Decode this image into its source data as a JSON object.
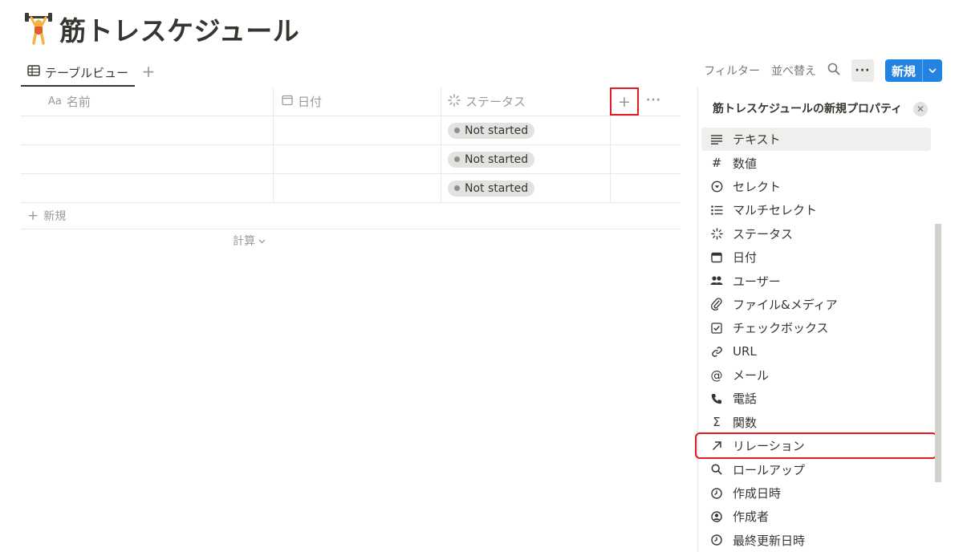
{
  "page": {
    "title": "筋トレスケジュール",
    "emoji": "weight-lifter-icon"
  },
  "tabs": {
    "active_label": "テーブルビュー",
    "add_label": "+"
  },
  "toolbar": {
    "filter": "フィルター",
    "sort": "並べ替え",
    "new": "新規"
  },
  "table": {
    "columns": [
      {
        "name": "名前",
        "icon": "Aa"
      },
      {
        "name": "日付",
        "icon": "calendar-icon"
      },
      {
        "name": "ステータス",
        "icon": "status-icon"
      }
    ],
    "rows": [
      {
        "status": "Not started"
      },
      {
        "status": "Not started"
      },
      {
        "status": "Not started"
      }
    ],
    "add_column": "+",
    "new_row": "新規",
    "calc": "計算"
  },
  "panel": {
    "title": "筋トレスケジュールの新規プロパティ",
    "items": [
      {
        "label": "テキスト",
        "icon": "text-icon"
      },
      {
        "label": "数値",
        "icon": "number-icon"
      },
      {
        "label": "セレクト",
        "icon": "select-icon"
      },
      {
        "label": "マルチセレクト",
        "icon": "multi-select-icon"
      },
      {
        "label": "ステータス",
        "icon": "status-icon"
      },
      {
        "label": "日付",
        "icon": "calendar-icon"
      },
      {
        "label": "ユーザー",
        "icon": "users-icon"
      },
      {
        "label": "ファイル&メディア",
        "icon": "paperclip-icon"
      },
      {
        "label": "チェックボックス",
        "icon": "checkbox-icon"
      },
      {
        "label": "URL",
        "icon": "link-icon"
      },
      {
        "label": "メール",
        "icon": "at-icon"
      },
      {
        "label": "電話",
        "icon": "phone-icon"
      },
      {
        "label": "関数",
        "icon": "sigma-icon"
      },
      {
        "label": "リレーション",
        "icon": "arrow-up-right-icon"
      },
      {
        "label": "ロールアップ",
        "icon": "search-icon"
      },
      {
        "label": "作成日時",
        "icon": "clock-icon"
      },
      {
        "label": "作成者",
        "icon": "user-circle-icon"
      },
      {
        "label": "最終更新日時",
        "icon": "clock-icon"
      }
    ]
  },
  "colors": {
    "accent": "#2383e2",
    "highlight": "#e21a22"
  }
}
